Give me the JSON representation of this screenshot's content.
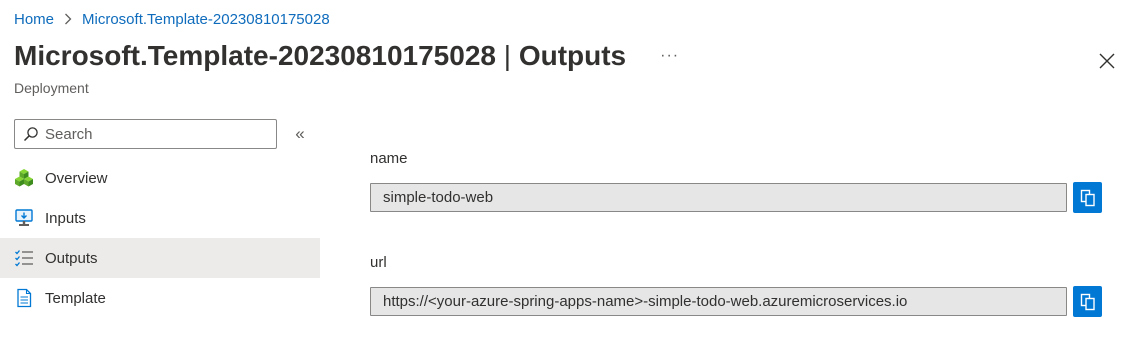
{
  "breadcrumb": {
    "home": "Home",
    "current": "Microsoft.Template-20230810175028"
  },
  "header": {
    "resource_name": "Microsoft.Template-20230810175028",
    "separator": " | ",
    "page": "Outputs",
    "more": "···",
    "subtitle": "Deployment"
  },
  "search": {
    "placeholder": "Search",
    "value": ""
  },
  "sidebar": {
    "collapse": "«",
    "items": [
      {
        "label": "Overview",
        "icon": "overview-icon"
      },
      {
        "label": "Inputs",
        "icon": "inputs-icon"
      },
      {
        "label": "Outputs",
        "icon": "outputs-icon",
        "active": true
      },
      {
        "label": "Template",
        "icon": "template-icon"
      }
    ]
  },
  "outputs": [
    {
      "label": "name",
      "value": "simple-todo-web"
    },
    {
      "label": "url",
      "value": "https://<your-azure-spring-apps-name>-simple-todo-web.azuremicroservices.io"
    }
  ],
  "colors": {
    "accent": "#0078d4",
    "link": "#0f6cbd",
    "active_nav_bg": "#edebe9",
    "readonly_field_bg": "#e6e6e6"
  }
}
